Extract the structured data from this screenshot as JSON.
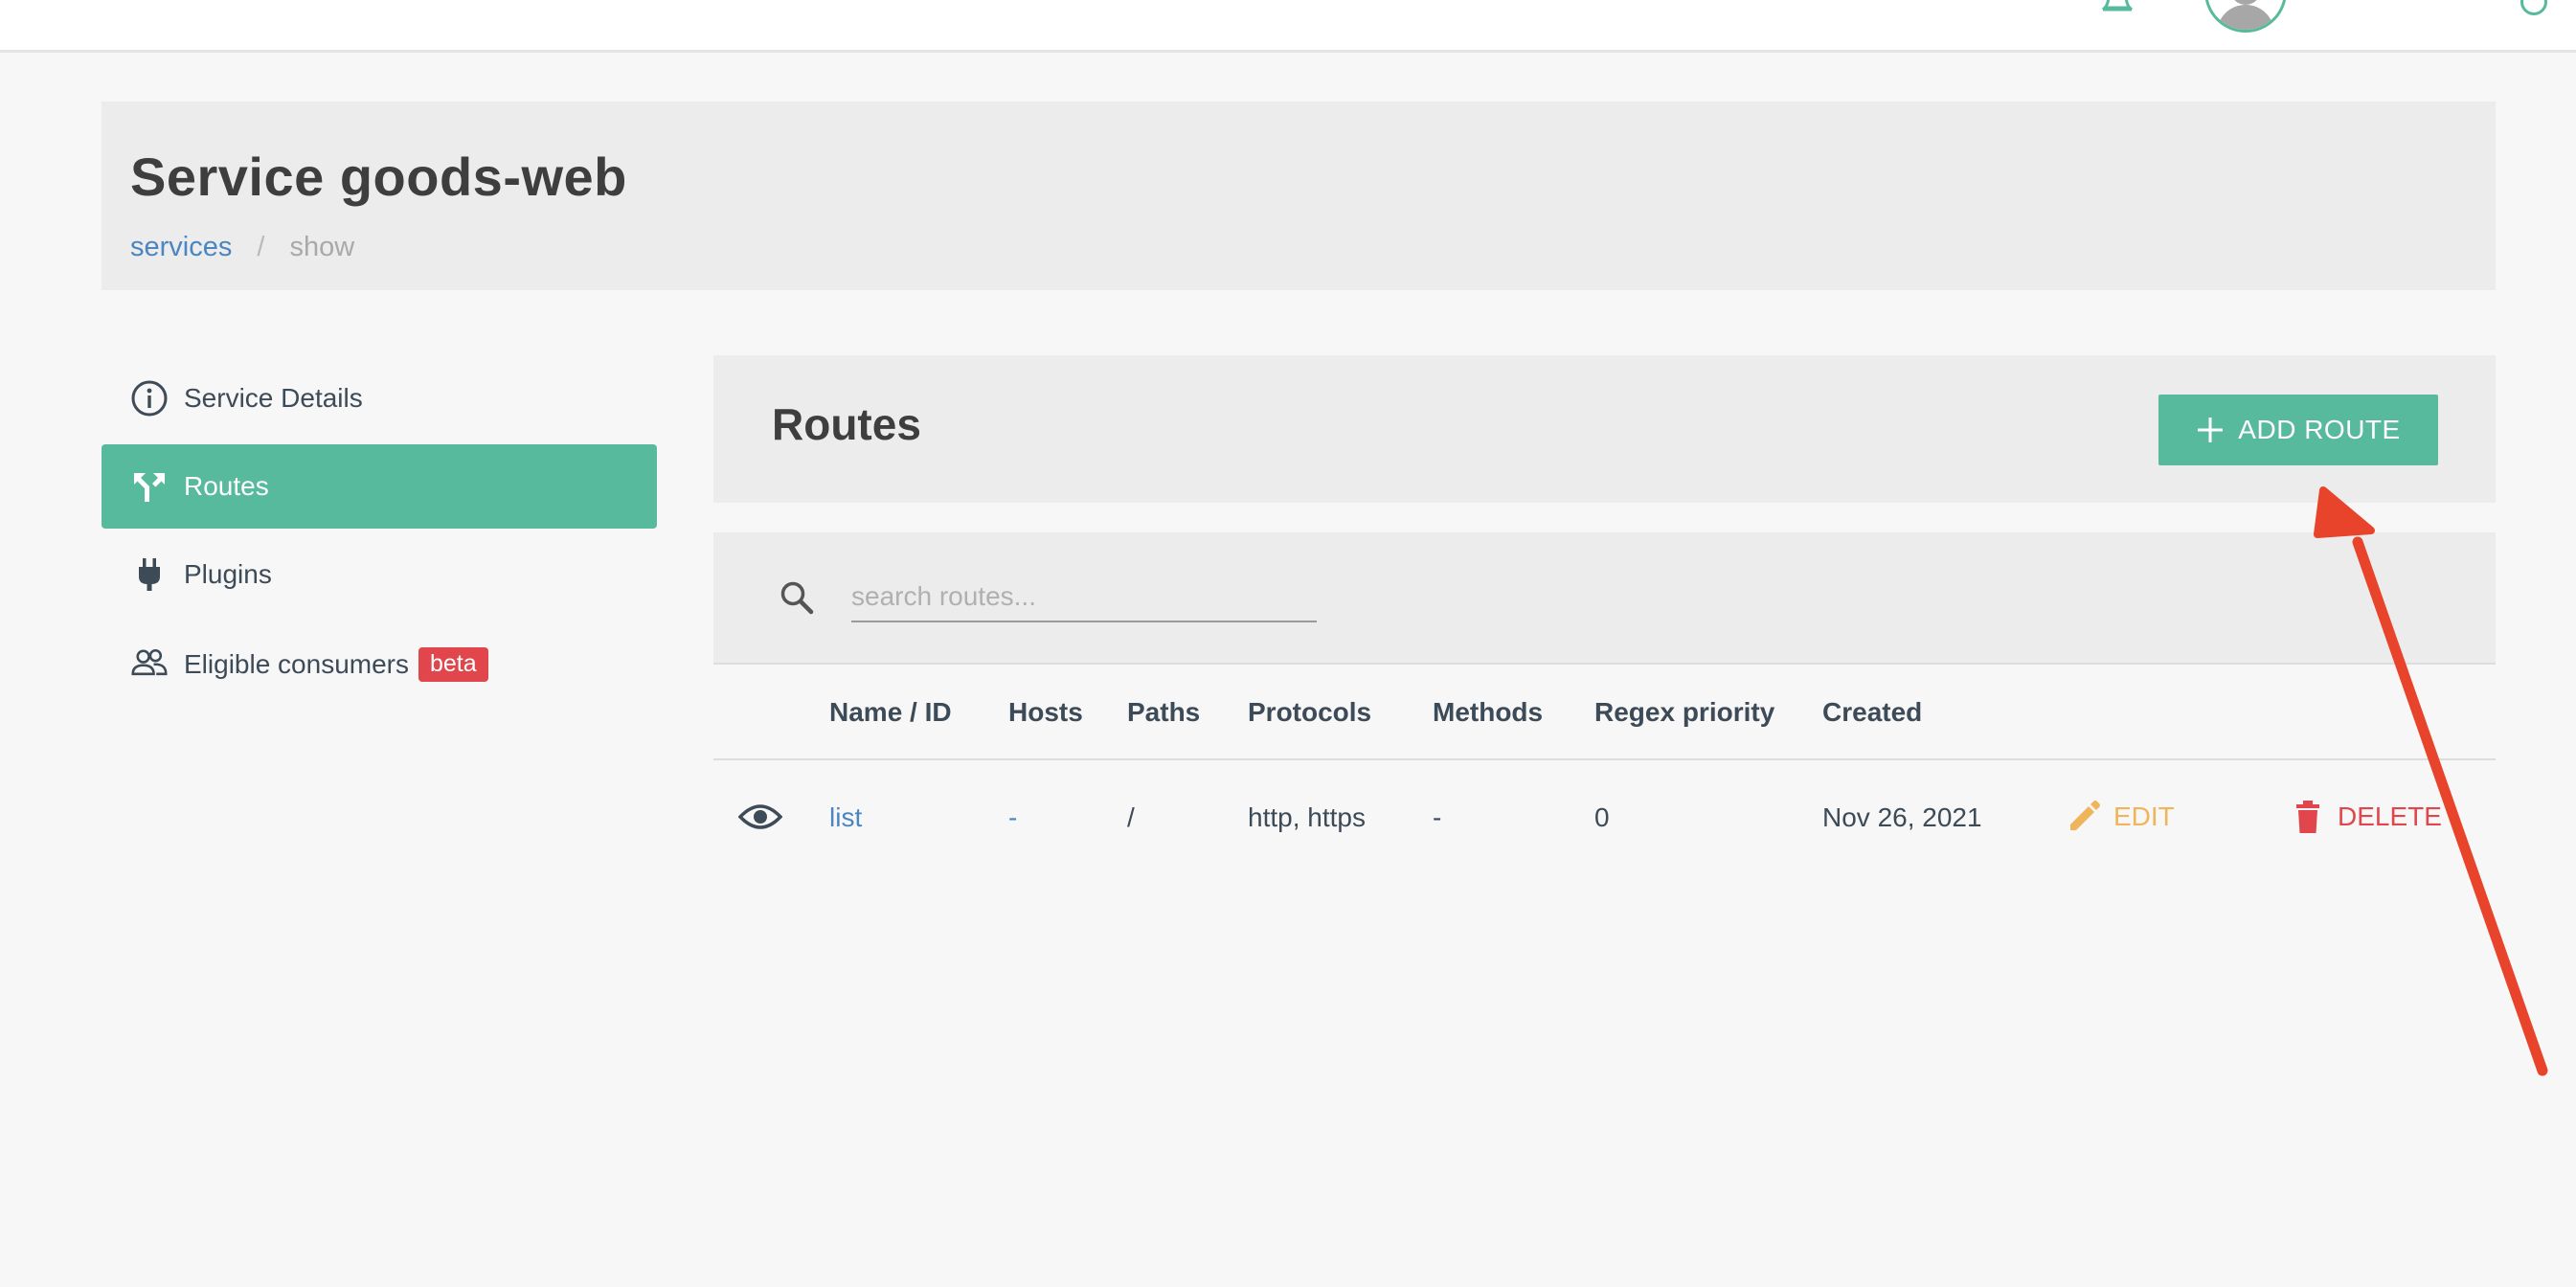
{
  "header": {
    "title": "Service goods-web",
    "breadcrumb": {
      "link": "services",
      "separator": "/",
      "current": "show"
    }
  },
  "sidebar": {
    "items": [
      {
        "label": "Service Details",
        "icon": "info-icon",
        "active": false
      },
      {
        "label": "Routes",
        "icon": "route-fork-icon",
        "active": true
      },
      {
        "label": "Plugins",
        "icon": "plug-icon",
        "active": false
      },
      {
        "label": "Eligible consumers",
        "icon": "users-icon",
        "active": false,
        "badge": "beta"
      }
    ]
  },
  "routes": {
    "title": "Routes",
    "add_button_label": "ADD ROUTE",
    "search_placeholder": "search routes...",
    "columns": [
      "Name / ID",
      "Hosts",
      "Paths",
      "Protocols",
      "Methods",
      "Regex priority",
      "Created"
    ],
    "rows": [
      {
        "name": "list",
        "hosts": "-",
        "paths": "/",
        "protocols": "http, https",
        "methods": "-",
        "regex_priority": "0",
        "created": "Nov 26, 2021",
        "edit_label": "EDIT",
        "delete_label": "DELETE"
      }
    ]
  },
  "colors": {
    "accent": "#58ba9c",
    "link": "#4a86c0",
    "edit": "#f0b45a",
    "delete": "#e0464b",
    "annotation_arrow": "#e8432b"
  }
}
